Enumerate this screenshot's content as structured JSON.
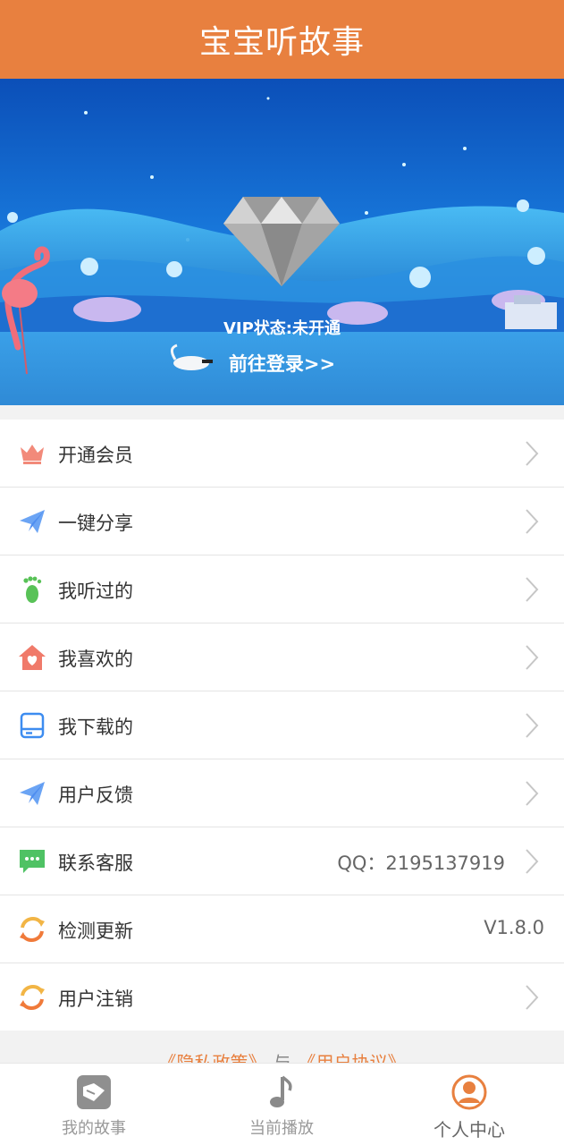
{
  "header": {
    "title": "宝宝听故事"
  },
  "banner": {
    "vip_status": "VIP状态:未开通",
    "login_link": "前往登录>>"
  },
  "menu": {
    "items": [
      {
        "label": "开通会员",
        "icon": "crown-icon",
        "value": ""
      },
      {
        "label": "一键分享",
        "icon": "paper-plane-icon",
        "value": ""
      },
      {
        "label": "我听过的",
        "icon": "footprint-icon",
        "value": ""
      },
      {
        "label": "我喜欢的",
        "icon": "heart-house-icon",
        "value": ""
      },
      {
        "label": "我下载的",
        "icon": "storage-drive-icon",
        "value": ""
      },
      {
        "label": "用户反馈",
        "icon": "paper-plane-icon",
        "value": ""
      },
      {
        "label": "联系客服",
        "icon": "chat-bubble-icon",
        "value": "QQ：2195137919"
      },
      {
        "label": "检测更新",
        "icon": "refresh-icon",
        "value": "V1.8.0"
      },
      {
        "label": "用户注销",
        "icon": "refresh-icon",
        "value": ""
      }
    ]
  },
  "footer": {
    "privacy": "《隐私政策》",
    "joiner": "与",
    "agreement": "《用户协议》"
  },
  "tabs": [
    {
      "label": "我的故事",
      "icon": "story-book-icon"
    },
    {
      "label": "当前播放",
      "icon": "music-note-icon"
    },
    {
      "label": "个人中心",
      "icon": "user-profile-icon"
    }
  ],
  "colors": {
    "brand": "#e8803f",
    "background": "#f2f2f2"
  }
}
